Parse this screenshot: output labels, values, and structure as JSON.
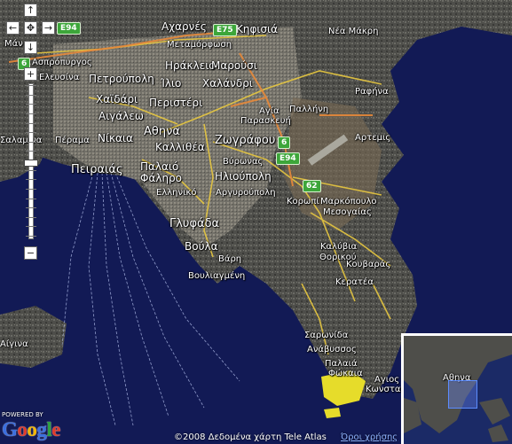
{
  "map": {
    "colors": {
      "sea": "#111a52",
      "land": "#4a4a46",
      "urban": "#6b6b66",
      "roads": "#e8c840",
      "highway": "#e88a3a",
      "highlight": "#e6dc2a"
    },
    "places": {
      "acharnes": "Αχαρνές",
      "kifisia": "Κηφισιά",
      "nea_makri": "Νέα Μάκρη",
      "metamorfosi": "Μεταμόρφωση",
      "aspropyrgos": "Ασπρόπυργος",
      "irakleio": "Ηράκλειο",
      "marousi": "Μαρούσι",
      "petroupoli": "Πετρούπολη",
      "ilio": "Ίλιο",
      "chalandri": "Χαλάνδρι",
      "elefsina": "Ελευσίνα",
      "chaidari": "Χαϊδάρι",
      "rafina": "Ραφήνα",
      "aigaleo": "Αιγάλεω",
      "peristeri": "Περιστέρι",
      "agia_paraskevi_1": "Αγία",
      "agia_paraskevi_2": "Παρασκευή",
      "pallini": "Παλλήνη",
      "salamina": "Σαλαμίνα",
      "perama": "Πέραμα",
      "nikaia": "Νίκαια",
      "athina": "Αθηνα",
      "zografou": "Ζωγράφου",
      "artemis": "Αρτεμις",
      "kallithea": "Καλλιθέα",
      "peiraias": "Πειραιάς",
      "vyronas": "Βύρωνας",
      "palaio": "Παλαιό",
      "faliro": "Φάληρο",
      "ilioupoli": "Ηλιούπολη",
      "elliniko": "Ελληνικό",
      "argyroupoli": "Αργυρούπολη",
      "koropi": "Κορωπί",
      "markopoulo_1": "Μαρκόπουλο",
      "markopoulo_2": "Μεσογαίας",
      "glyfada": "Γλυφάδα",
      "kalyvia_1": "Καλύβια",
      "kalyvia_2": "Θορικού",
      "voula": "Βούλα",
      "vari": "Βάρη",
      "kouvaras": "Κουβαράς",
      "vouliagmeni": "Βουλιαγμένη",
      "keratea": "Κερατέα",
      "saronida": "Σαρωνίδα",
      "anavyssos": "Ανάβυσσος",
      "palaia_fokaia_1": "Παλαιά",
      "palaia_fokaia_2": "Φώκαια",
      "agios": "Αγιος",
      "konstantinos": "Κωνσταντίν",
      "aigina": "Αίγινα",
      "mani": "Μάν",
      "overview_athina": "Αθηνα"
    },
    "shields": {
      "e75": "E75",
      "e94_nw": "E94",
      "r6": "6",
      "e94": "E94",
      "r62": "62",
      "e94_left": "6"
    },
    "controls": {
      "pan_up": "↑",
      "pan_left": "←",
      "pan_center": "✥",
      "pan_right": "→",
      "pan_down": "↓",
      "zoom_in": "+",
      "zoom_out": "−",
      "zoom_level_fraction": 0.48
    },
    "logo": {
      "powered": "POWERED BY",
      "g1": "G",
      "o1": "o",
      "o2": "o",
      "g2": "g",
      "l": "l",
      "e": "e"
    },
    "copyright": "©2008 Δεδομένα χάρτη Tele Atlas",
    "terms": "Όροι χρήσης"
  }
}
